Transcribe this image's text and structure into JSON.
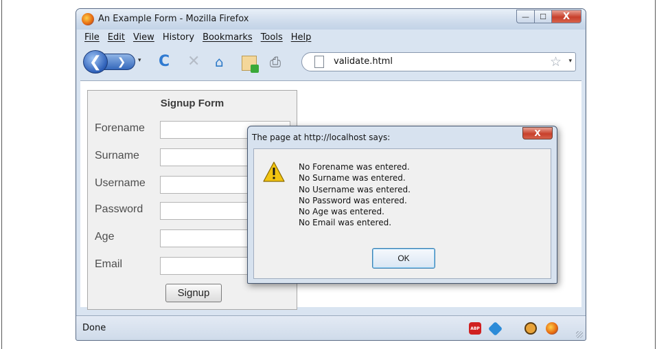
{
  "window": {
    "title": "An Example Form - Mozilla Firefox",
    "minimize": "—",
    "maximize": "☐",
    "close": "X"
  },
  "menu": [
    "File",
    "Edit",
    "View",
    "History",
    "Bookmarks",
    "Tools",
    "Help"
  ],
  "nav": {
    "back_glyph": "❮",
    "forward_glyph": "❯",
    "reload_glyph": "C",
    "stop_glyph": "✕",
    "home_glyph": "⌂",
    "print_glyph": "⎙",
    "url": "validate.html",
    "star_glyph": "☆",
    "dropdown_glyph": "▾"
  },
  "form": {
    "title": "Signup Form",
    "fields": [
      "Forename",
      "Surname",
      "Username",
      "Password",
      "Age",
      "Email"
    ],
    "submit": "Signup"
  },
  "dialog": {
    "title": "The page at http://localhost says:",
    "close": "X",
    "messages": [
      "No Forename was entered.",
      "No Surname was entered.",
      "No Username was entered.",
      "No Password was entered.",
      "No Age was entered.",
      "No Email was entered."
    ],
    "ok": "OK"
  },
  "status": {
    "text": "Done",
    "abp": "ABP"
  },
  "colors": {
    "chrome": "#d9e4f1",
    "close_red": "#c8402b",
    "warning_yellow": "#f2c411"
  }
}
